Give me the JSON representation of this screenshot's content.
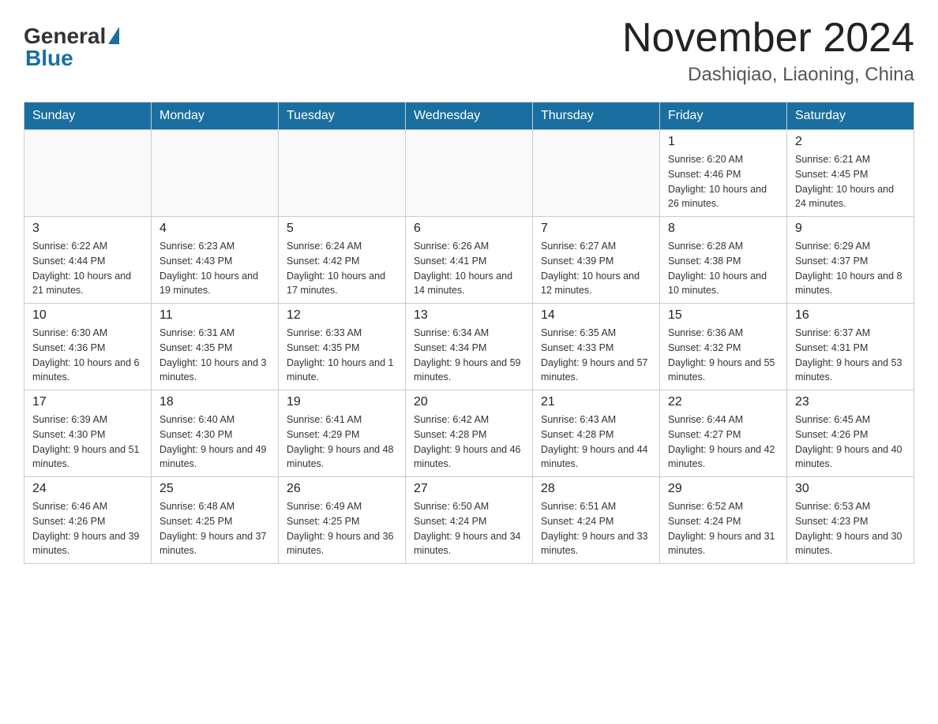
{
  "header": {
    "logo_text": "General",
    "logo_blue": "Blue",
    "title": "November 2024",
    "location": "Dashiqiao, Liaoning, China"
  },
  "weekdays": [
    "Sunday",
    "Monday",
    "Tuesday",
    "Wednesday",
    "Thursday",
    "Friday",
    "Saturday"
  ],
  "weeks": [
    [
      {
        "day": "",
        "info": ""
      },
      {
        "day": "",
        "info": ""
      },
      {
        "day": "",
        "info": ""
      },
      {
        "day": "",
        "info": ""
      },
      {
        "day": "",
        "info": ""
      },
      {
        "day": "1",
        "info": "Sunrise: 6:20 AM\nSunset: 4:46 PM\nDaylight: 10 hours and 26 minutes."
      },
      {
        "day": "2",
        "info": "Sunrise: 6:21 AM\nSunset: 4:45 PM\nDaylight: 10 hours and 24 minutes."
      }
    ],
    [
      {
        "day": "3",
        "info": "Sunrise: 6:22 AM\nSunset: 4:44 PM\nDaylight: 10 hours and 21 minutes."
      },
      {
        "day": "4",
        "info": "Sunrise: 6:23 AM\nSunset: 4:43 PM\nDaylight: 10 hours and 19 minutes."
      },
      {
        "day": "5",
        "info": "Sunrise: 6:24 AM\nSunset: 4:42 PM\nDaylight: 10 hours and 17 minutes."
      },
      {
        "day": "6",
        "info": "Sunrise: 6:26 AM\nSunset: 4:41 PM\nDaylight: 10 hours and 14 minutes."
      },
      {
        "day": "7",
        "info": "Sunrise: 6:27 AM\nSunset: 4:39 PM\nDaylight: 10 hours and 12 minutes."
      },
      {
        "day": "8",
        "info": "Sunrise: 6:28 AM\nSunset: 4:38 PM\nDaylight: 10 hours and 10 minutes."
      },
      {
        "day": "9",
        "info": "Sunrise: 6:29 AM\nSunset: 4:37 PM\nDaylight: 10 hours and 8 minutes."
      }
    ],
    [
      {
        "day": "10",
        "info": "Sunrise: 6:30 AM\nSunset: 4:36 PM\nDaylight: 10 hours and 6 minutes."
      },
      {
        "day": "11",
        "info": "Sunrise: 6:31 AM\nSunset: 4:35 PM\nDaylight: 10 hours and 3 minutes."
      },
      {
        "day": "12",
        "info": "Sunrise: 6:33 AM\nSunset: 4:35 PM\nDaylight: 10 hours and 1 minute."
      },
      {
        "day": "13",
        "info": "Sunrise: 6:34 AM\nSunset: 4:34 PM\nDaylight: 9 hours and 59 minutes."
      },
      {
        "day": "14",
        "info": "Sunrise: 6:35 AM\nSunset: 4:33 PM\nDaylight: 9 hours and 57 minutes."
      },
      {
        "day": "15",
        "info": "Sunrise: 6:36 AM\nSunset: 4:32 PM\nDaylight: 9 hours and 55 minutes."
      },
      {
        "day": "16",
        "info": "Sunrise: 6:37 AM\nSunset: 4:31 PM\nDaylight: 9 hours and 53 minutes."
      }
    ],
    [
      {
        "day": "17",
        "info": "Sunrise: 6:39 AM\nSunset: 4:30 PM\nDaylight: 9 hours and 51 minutes."
      },
      {
        "day": "18",
        "info": "Sunrise: 6:40 AM\nSunset: 4:30 PM\nDaylight: 9 hours and 49 minutes."
      },
      {
        "day": "19",
        "info": "Sunrise: 6:41 AM\nSunset: 4:29 PM\nDaylight: 9 hours and 48 minutes."
      },
      {
        "day": "20",
        "info": "Sunrise: 6:42 AM\nSunset: 4:28 PM\nDaylight: 9 hours and 46 minutes."
      },
      {
        "day": "21",
        "info": "Sunrise: 6:43 AM\nSunset: 4:28 PM\nDaylight: 9 hours and 44 minutes."
      },
      {
        "day": "22",
        "info": "Sunrise: 6:44 AM\nSunset: 4:27 PM\nDaylight: 9 hours and 42 minutes."
      },
      {
        "day": "23",
        "info": "Sunrise: 6:45 AM\nSunset: 4:26 PM\nDaylight: 9 hours and 40 minutes."
      }
    ],
    [
      {
        "day": "24",
        "info": "Sunrise: 6:46 AM\nSunset: 4:26 PM\nDaylight: 9 hours and 39 minutes."
      },
      {
        "day": "25",
        "info": "Sunrise: 6:48 AM\nSunset: 4:25 PM\nDaylight: 9 hours and 37 minutes."
      },
      {
        "day": "26",
        "info": "Sunrise: 6:49 AM\nSunset: 4:25 PM\nDaylight: 9 hours and 36 minutes."
      },
      {
        "day": "27",
        "info": "Sunrise: 6:50 AM\nSunset: 4:24 PM\nDaylight: 9 hours and 34 minutes."
      },
      {
        "day": "28",
        "info": "Sunrise: 6:51 AM\nSunset: 4:24 PM\nDaylight: 9 hours and 33 minutes."
      },
      {
        "day": "29",
        "info": "Sunrise: 6:52 AM\nSunset: 4:24 PM\nDaylight: 9 hours and 31 minutes."
      },
      {
        "day": "30",
        "info": "Sunrise: 6:53 AM\nSunset: 4:23 PM\nDaylight: 9 hours and 30 minutes."
      }
    ]
  ]
}
